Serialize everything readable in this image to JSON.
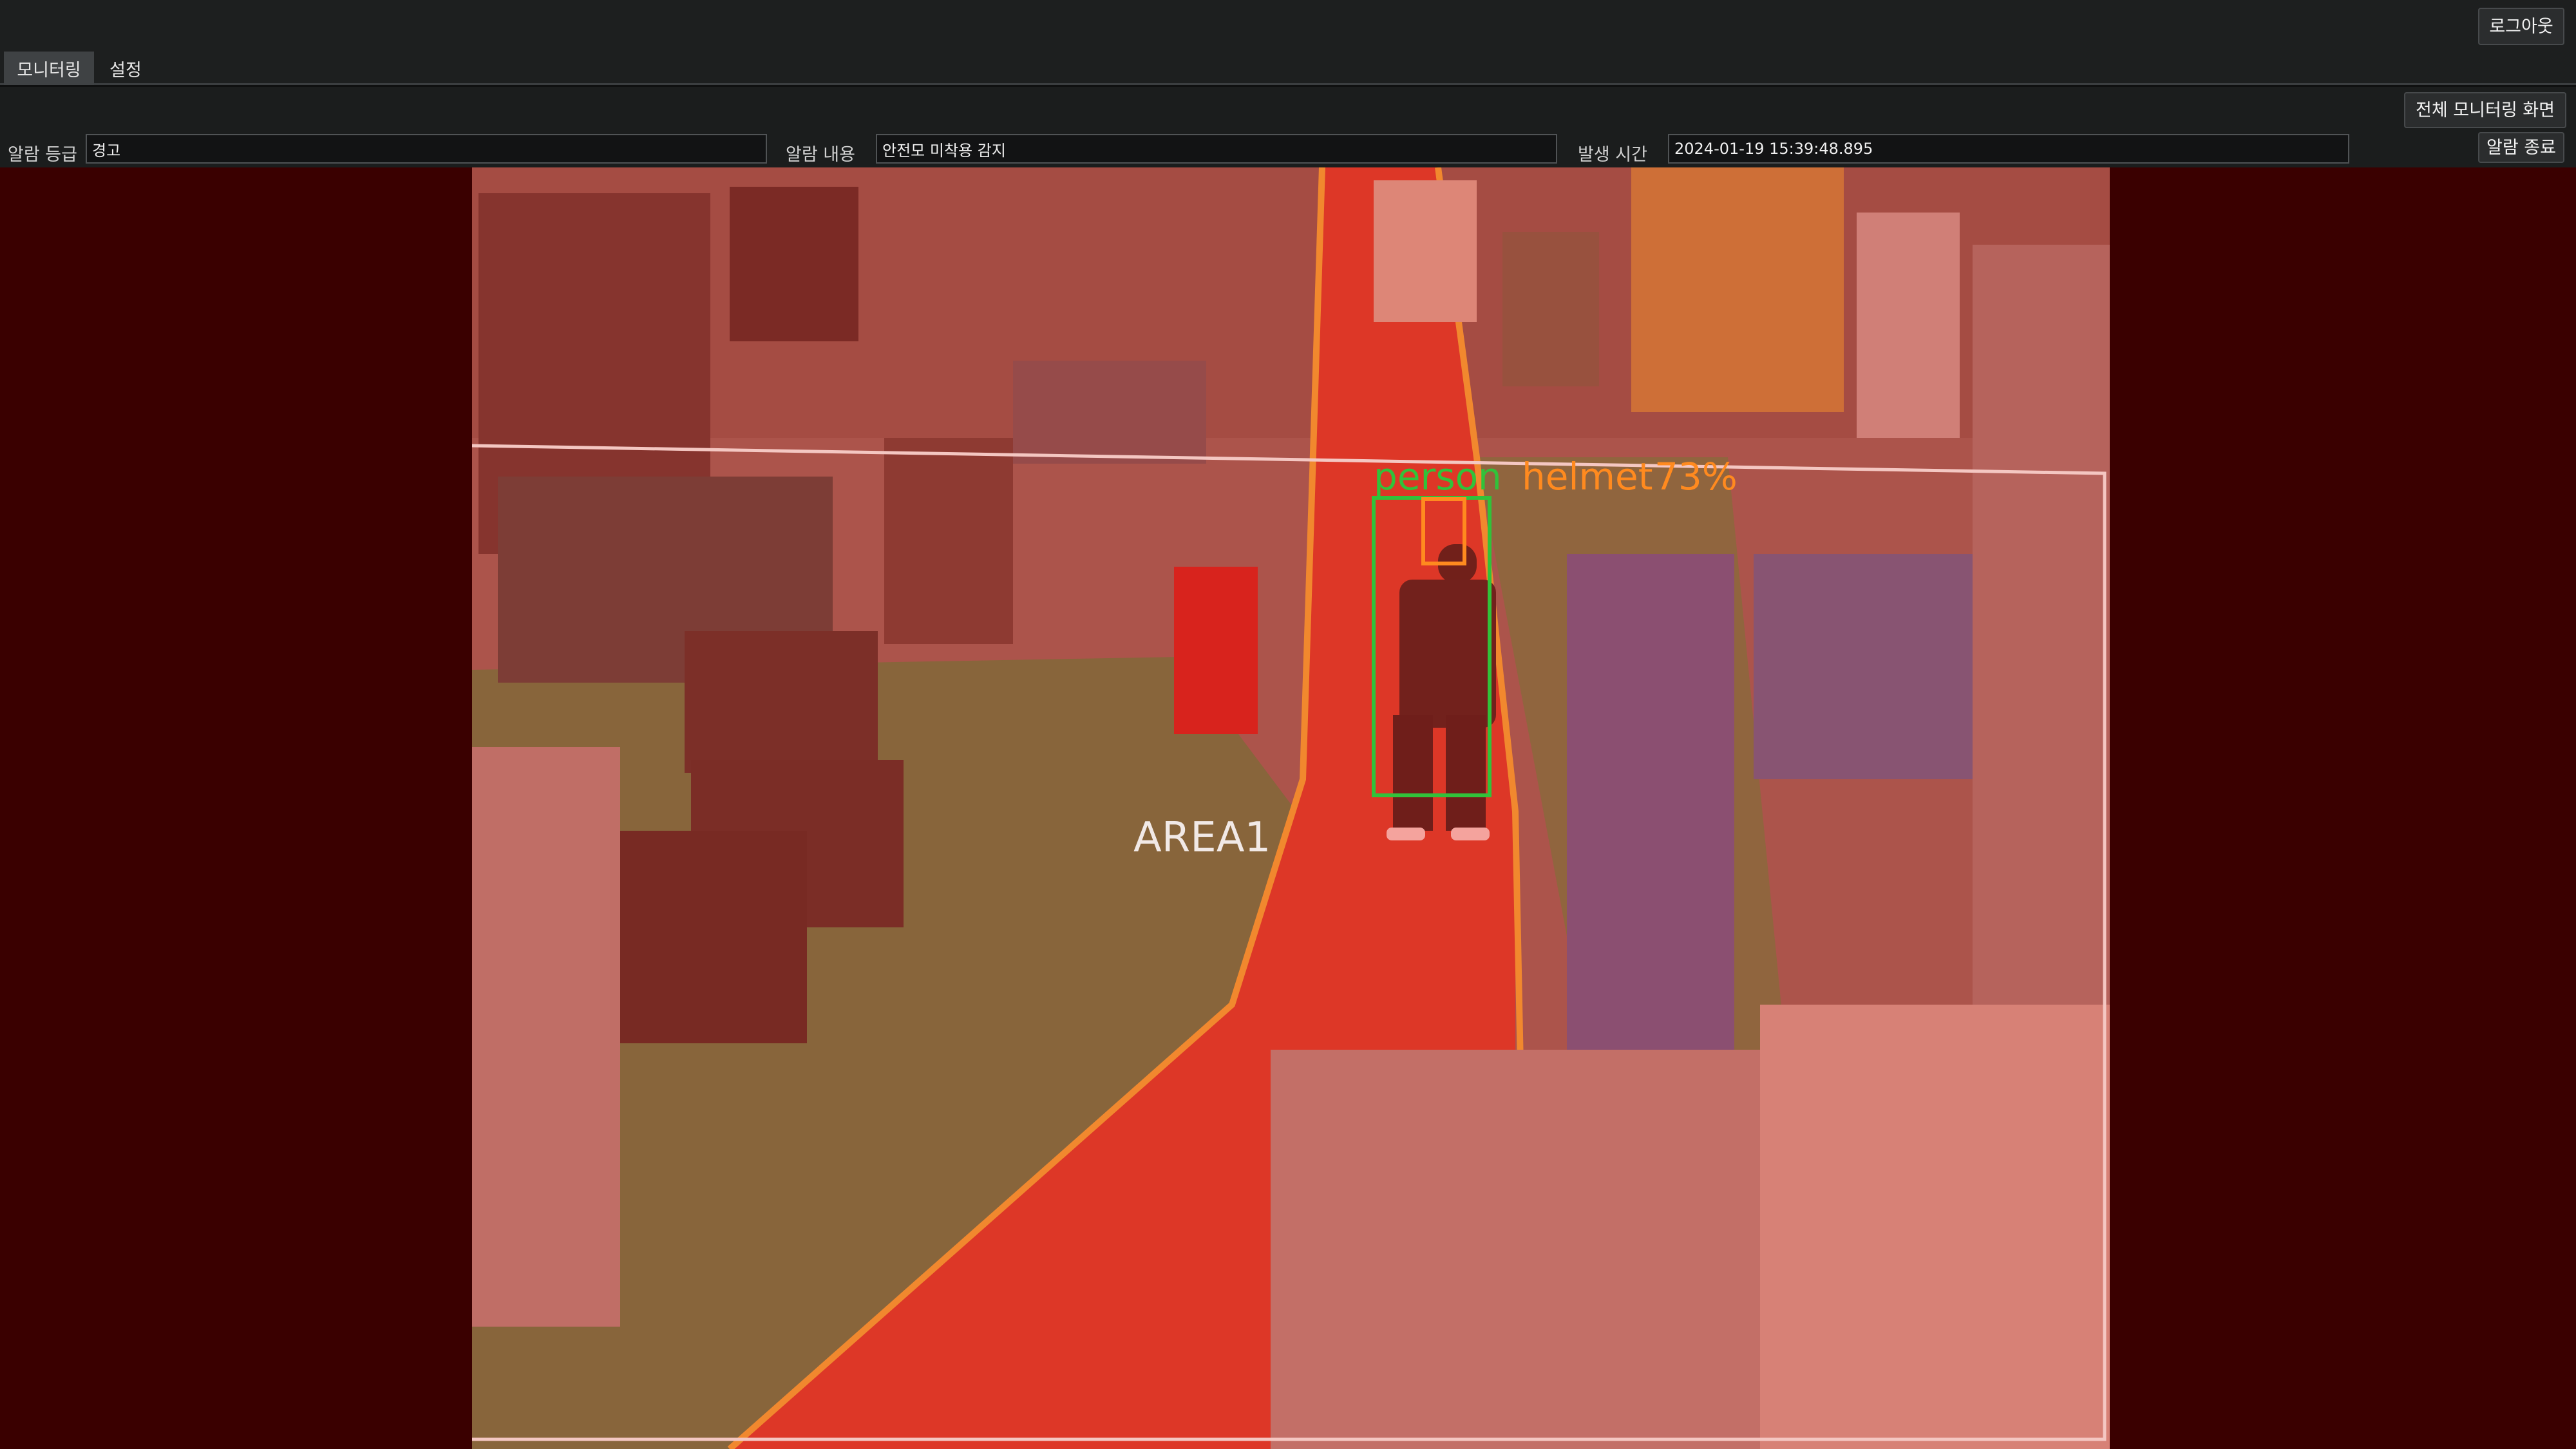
{
  "header": {
    "logout_label": "로그아웃"
  },
  "tabs": [
    {
      "label": "모니터링",
      "active": true
    },
    {
      "label": "설정",
      "active": false
    }
  ],
  "toolbar": {
    "full_monitoring_label": "전체 모니터링 화면",
    "alarm_end_label": "알람 종료"
  },
  "alarm": {
    "level_label": "알람 등급",
    "level_value": "경고",
    "content_label": "알람 내용",
    "content_value": "안전모 미착용 감지",
    "time_label": "발생 시간",
    "time_value": "2024-01-19 15:39:48.895"
  },
  "video": {
    "area_label": "AREA1",
    "detection_label": "person",
    "detection_overlap": "helmet",
    "detection_score": "73%",
    "colors": {
      "alarm_tint": "#ff2a1a",
      "person_box": "#31c23a",
      "helmet_box": "#ff8a1f",
      "zone_line": "#f4c7c2"
    }
  }
}
